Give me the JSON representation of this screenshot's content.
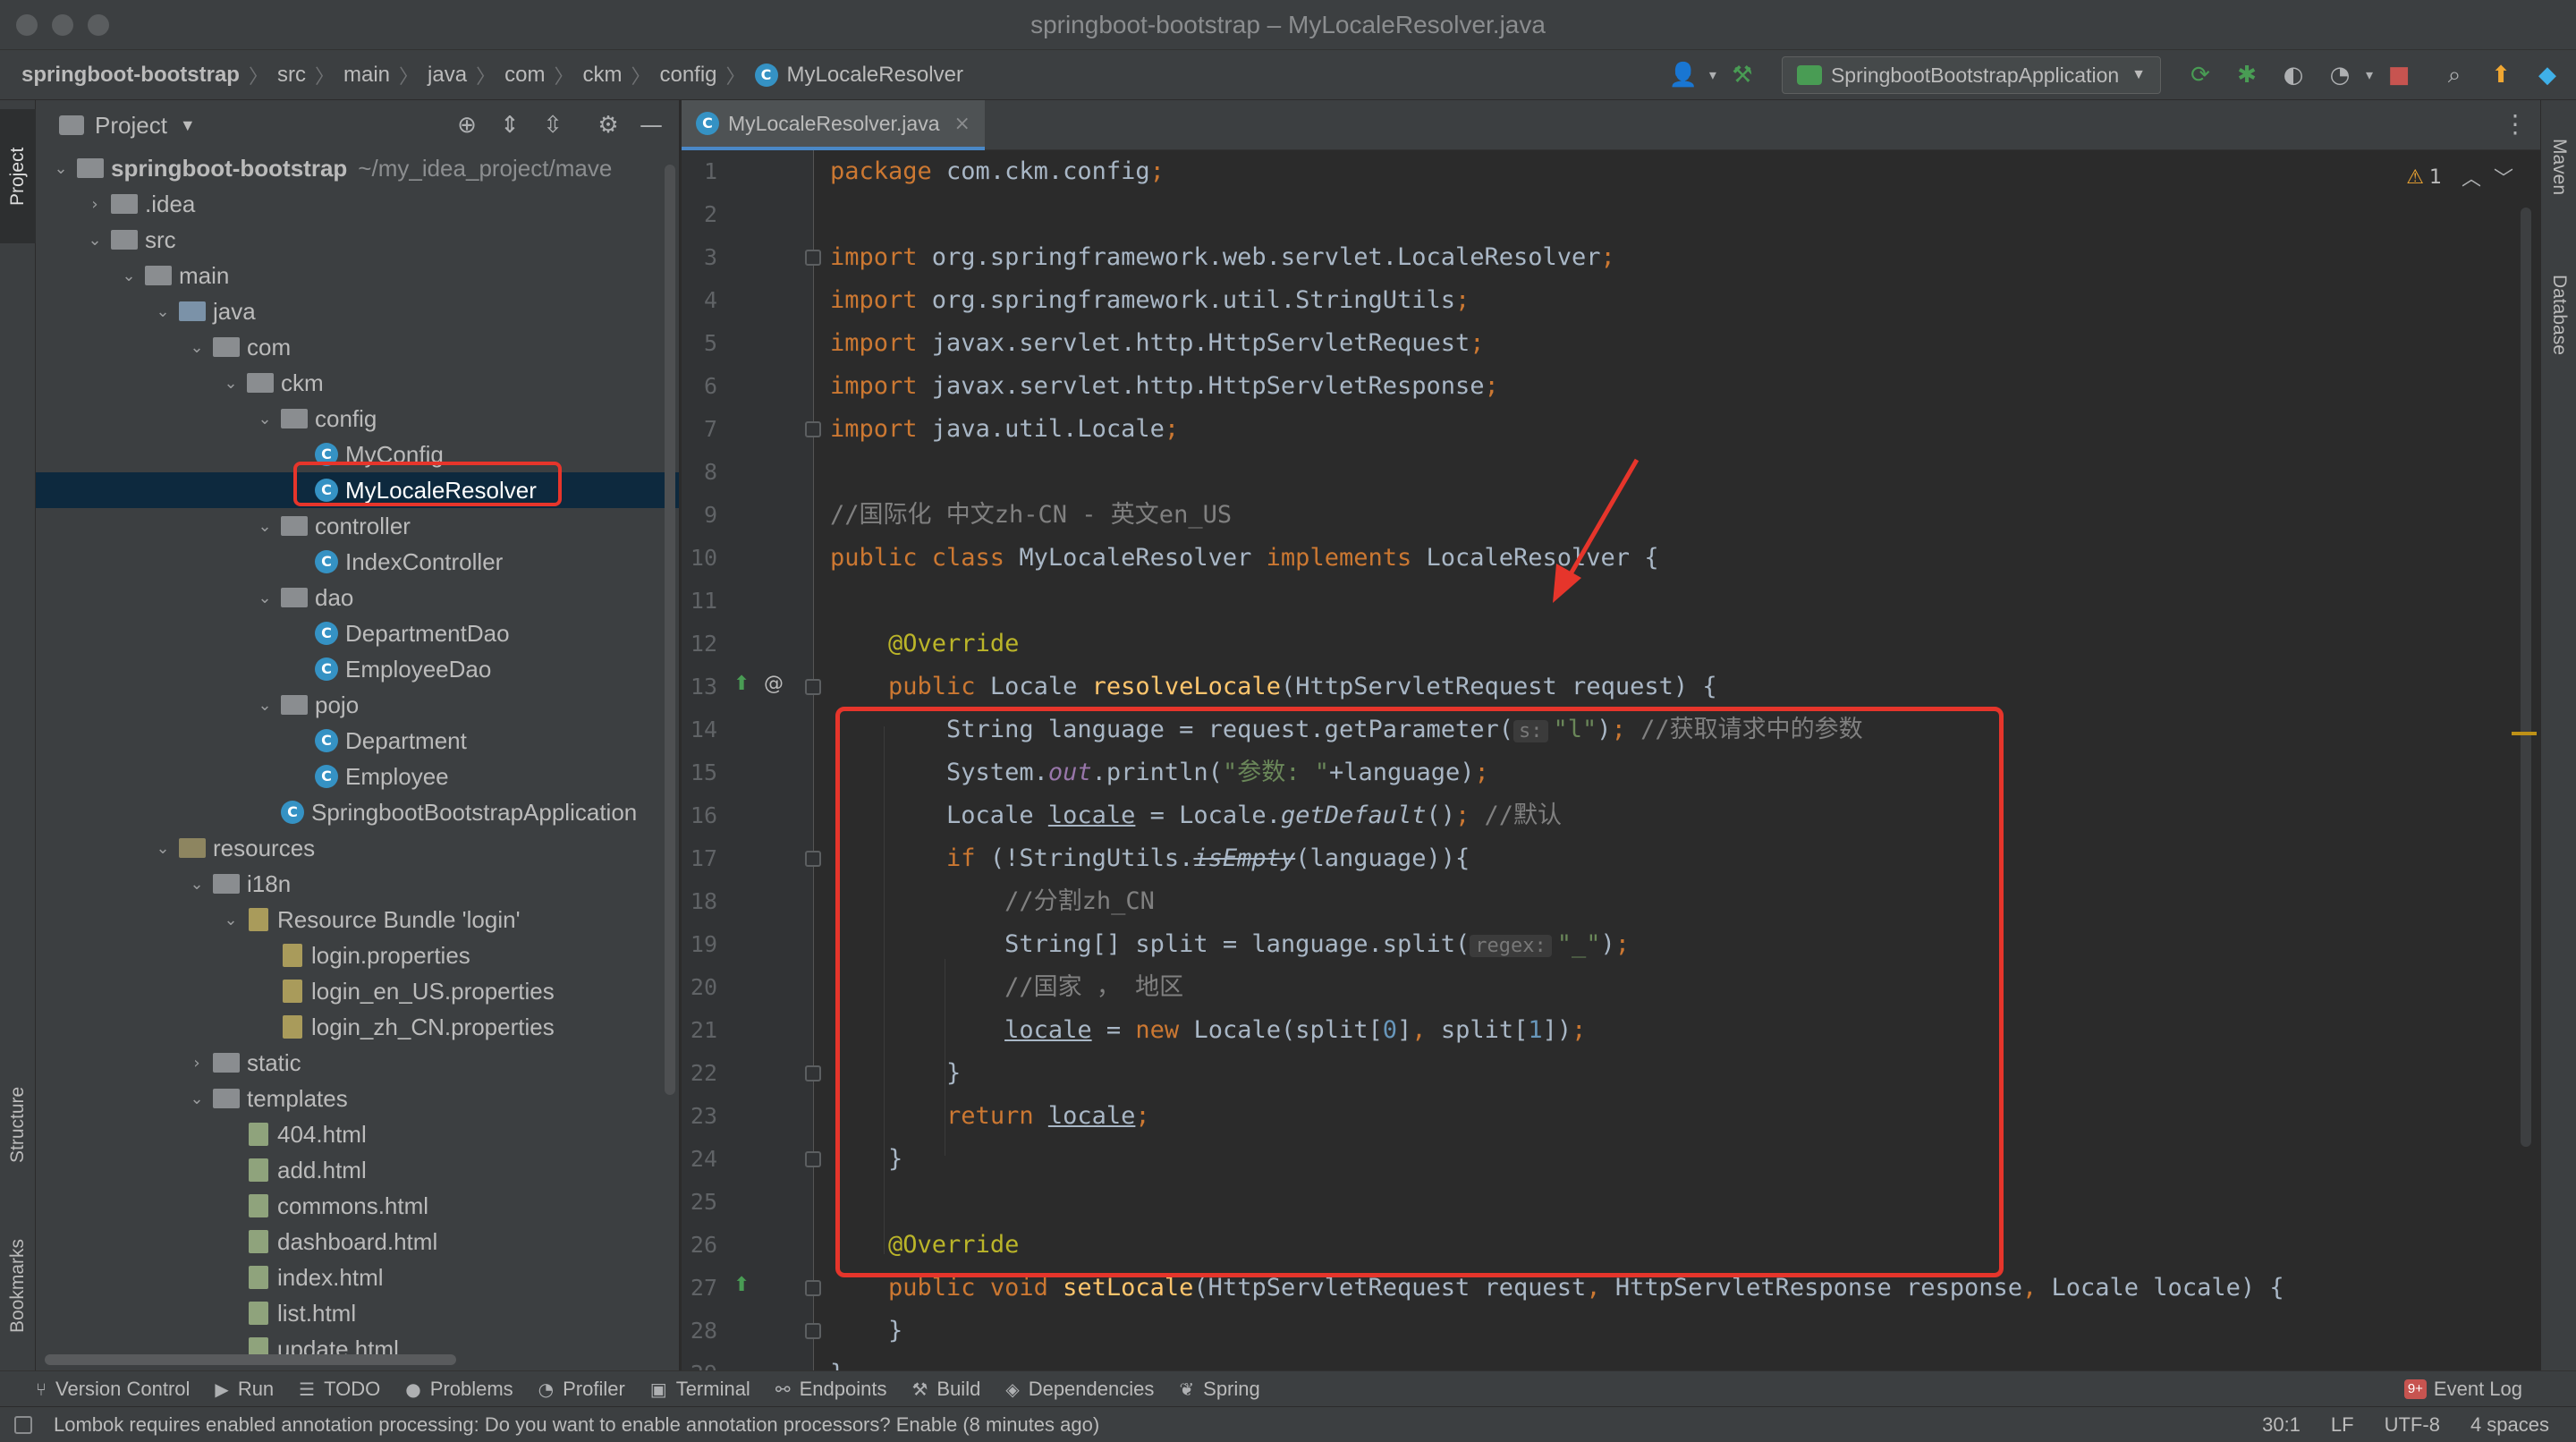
{
  "window": {
    "title": "springboot-bootstrap – MyLocaleResolver.java"
  },
  "breadcrumbs": [
    "springboot-bootstrap",
    "src",
    "main",
    "java",
    "com",
    "ckm",
    "config",
    "MyLocaleResolver"
  ],
  "run_config": {
    "label": "SpringbootBootstrapApplication"
  },
  "toolbar_icons": [
    "user-icon",
    "build-hammer-icon",
    "rerun-icon",
    "debug-icon",
    "coverage-icon",
    "profile-icon",
    "stop-icon",
    "search-icon",
    "update-icon",
    "plugin-icon"
  ],
  "left_strip": {
    "project": "Project",
    "structure": "Structure",
    "bookmarks": "Bookmarks"
  },
  "right_strip": {
    "maven": "Maven",
    "database": "Database"
  },
  "project_panel": {
    "title": "Project",
    "tree": [
      {
        "label": "springboot-bootstrap",
        "extra": "~/my_idea_project/mave",
        "type": "module",
        "depth": 0,
        "expanded": true,
        "bold": true
      },
      {
        "label": ".idea",
        "type": "folder",
        "depth": 1,
        "expanded": false
      },
      {
        "label": "src",
        "type": "folder",
        "depth": 1,
        "expanded": true
      },
      {
        "label": "main",
        "type": "folder",
        "depth": 2,
        "expanded": true
      },
      {
        "label": "java",
        "type": "src",
        "depth": 3,
        "expanded": true
      },
      {
        "label": "com",
        "type": "folder",
        "depth": 4,
        "expanded": true
      },
      {
        "label": "ckm",
        "type": "folder",
        "depth": 5,
        "expanded": true
      },
      {
        "label": "config",
        "type": "folder",
        "depth": 6,
        "expanded": true
      },
      {
        "label": "MyConfig",
        "type": "class",
        "depth": 7
      },
      {
        "label": "MyLocaleResolver",
        "type": "class",
        "depth": 7,
        "selected": true
      },
      {
        "label": "controller",
        "type": "folder",
        "depth": 6,
        "expanded": true
      },
      {
        "label": "IndexController",
        "type": "class",
        "depth": 7
      },
      {
        "label": "dao",
        "type": "folder",
        "depth": 6,
        "expanded": true
      },
      {
        "label": "DepartmentDao",
        "type": "class",
        "depth": 7
      },
      {
        "label": "EmployeeDao",
        "type": "class",
        "depth": 7
      },
      {
        "label": "pojo",
        "type": "folder",
        "depth": 6,
        "expanded": true
      },
      {
        "label": "Department",
        "type": "class",
        "depth": 7
      },
      {
        "label": "Employee",
        "type": "class",
        "depth": 7
      },
      {
        "label": "SpringbootBootstrapApplication",
        "type": "class",
        "depth": 6
      },
      {
        "label": "resources",
        "type": "res",
        "depth": 3,
        "expanded": true
      },
      {
        "label": "i18n",
        "type": "folder",
        "depth": 4,
        "expanded": true
      },
      {
        "label": "Resource Bundle 'login'",
        "type": "bundle",
        "depth": 5,
        "expanded": true
      },
      {
        "label": "login.properties",
        "type": "props",
        "depth": 6
      },
      {
        "label": "login_en_US.properties",
        "type": "props",
        "depth": 6
      },
      {
        "label": "login_zh_CN.properties",
        "type": "props",
        "depth": 6
      },
      {
        "label": "static",
        "type": "folder",
        "depth": 4,
        "expanded": false
      },
      {
        "label": "templates",
        "type": "folder",
        "depth": 4,
        "expanded": true
      },
      {
        "label": "404.html",
        "type": "html",
        "depth": 5
      },
      {
        "label": "add.html",
        "type": "html",
        "depth": 5
      },
      {
        "label": "commons.html",
        "type": "html",
        "depth": 5
      },
      {
        "label": "dashboard.html",
        "type": "html",
        "depth": 5
      },
      {
        "label": "index.html",
        "type": "html",
        "depth": 5
      },
      {
        "label": "list.html",
        "type": "html",
        "depth": 5
      },
      {
        "label": "update.html",
        "type": "html",
        "depth": 5
      }
    ]
  },
  "editor": {
    "tab_label": "MyLocaleResolver.java",
    "inspection": {
      "warnings": "1"
    },
    "lines": [
      {
        "n": "1",
        "t": [
          [
            "kw",
            "package "
          ],
          [
            "",
            "com.ckm.config"
          ],
          [
            "kw",
            ";"
          ]
        ]
      },
      {
        "n": "2",
        "t": []
      },
      {
        "n": "3",
        "t": [
          [
            "kw",
            "import "
          ],
          [
            "",
            "org.springframework.web.servlet.LocaleResolver"
          ],
          [
            "kw",
            ";"
          ]
        ]
      },
      {
        "n": "4",
        "t": [
          [
            "kw",
            "import "
          ],
          [
            "",
            "org.springframework.util.StringUtils"
          ],
          [
            "kw",
            ";"
          ]
        ]
      },
      {
        "n": "5",
        "t": [
          [
            "kw",
            "import "
          ],
          [
            "",
            "javax.servlet.http.HttpServletRequest"
          ],
          [
            "kw",
            ";"
          ]
        ]
      },
      {
        "n": "6",
        "t": [
          [
            "kw",
            "import "
          ],
          [
            "",
            "javax.servlet.http.HttpServletResponse"
          ],
          [
            "kw",
            ";"
          ]
        ]
      },
      {
        "n": "7",
        "t": [
          [
            "kw",
            "import "
          ],
          [
            "",
            "java.util.Locale"
          ],
          [
            "kw",
            ";"
          ]
        ]
      },
      {
        "n": "8",
        "t": []
      },
      {
        "n": "9",
        "t": [
          [
            "cm",
            "//国际化 中文zh-CN - 英文en_US"
          ]
        ]
      },
      {
        "n": "10",
        "t": [
          [
            "kw",
            "public class "
          ],
          [
            "",
            "MyLocaleResolver "
          ],
          [
            "kw",
            "implements "
          ],
          [
            "",
            "LocaleResolver {"
          ]
        ]
      },
      {
        "n": "11",
        "t": []
      },
      {
        "n": "12",
        "t": [
          [
            "",
            "    "
          ],
          [
            "an",
            "@Override"
          ]
        ]
      },
      {
        "n": "13",
        "t": [
          [
            "",
            "    "
          ],
          [
            "kw",
            "public "
          ],
          [
            "",
            "Locale "
          ],
          [
            "fn",
            "resolveLocale"
          ],
          [
            "",
            "(HttpServletRequest request) {"
          ]
        ]
      },
      {
        "n": "14",
        "t": [
          [
            "",
            "        String language = request.getParameter("
          ],
          [
            "hint",
            "s:"
          ],
          [
            "",
            ""
          ],
          [
            "st",
            "\"l\""
          ],
          [
            "",
            ")"
          ],
          [
            "kw",
            "; "
          ],
          [
            "cm",
            "//获取请求中的参数"
          ]
        ]
      },
      {
        "n": "15",
        "t": [
          [
            "",
            "        System."
          ],
          [
            "it",
            "out"
          ],
          [
            "",
            ".println("
          ],
          [
            "st",
            "\"参数: \""
          ],
          [
            "",
            "+language)"
          ],
          [
            "kw",
            ";"
          ]
        ]
      },
      {
        "n": "16",
        "t": [
          [
            "",
            "        Locale "
          ],
          [
            "ul",
            "locale"
          ],
          [
            "",
            " = Locale."
          ],
          [
            "itf",
            "getDefault"
          ],
          [
            "",
            "()"
          ],
          [
            "kw",
            "; "
          ],
          [
            "cm",
            "//默认"
          ]
        ]
      },
      {
        "n": "17",
        "t": [
          [
            "",
            "        "
          ],
          [
            "kw",
            "if "
          ],
          [
            "",
            "(!StringUtils."
          ],
          [
            "strike",
            "isEmpty"
          ],
          [
            "",
            "(language)){"
          ]
        ]
      },
      {
        "n": "18",
        "t": [
          [
            "",
            "            "
          ],
          [
            "cm",
            "//分割zh_CN"
          ]
        ]
      },
      {
        "n": "19",
        "t": [
          [
            "",
            "            String[] split = language.split("
          ],
          [
            "hint",
            "regex:"
          ],
          [
            "",
            ""
          ],
          [
            "st",
            "\"_\""
          ],
          [
            "",
            ")"
          ],
          [
            "kw",
            ";"
          ]
        ]
      },
      {
        "n": "20",
        "t": [
          [
            "",
            "            "
          ],
          [
            "cm",
            "//国家 ， 地区"
          ]
        ]
      },
      {
        "n": "21",
        "t": [
          [
            "",
            "            "
          ],
          [
            "ul",
            "locale"
          ],
          [
            "",
            " = "
          ],
          [
            "kw",
            "new "
          ],
          [
            "",
            "Locale(split["
          ],
          [
            "num",
            "0"
          ],
          [
            "",
            "]"
          ],
          [
            "kw",
            ", "
          ],
          [
            "",
            "split["
          ],
          [
            "num",
            "1"
          ],
          [
            "",
            "])"
          ],
          [
            "kw",
            ";"
          ]
        ]
      },
      {
        "n": "22",
        "t": [
          [
            "",
            "        }"
          ]
        ]
      },
      {
        "n": "23",
        "t": [
          [
            "",
            "        "
          ],
          [
            "kw",
            "return "
          ],
          [
            "ul",
            "locale"
          ],
          [
            "kw",
            ";"
          ]
        ]
      },
      {
        "n": "24",
        "t": [
          [
            "",
            "    }"
          ]
        ]
      },
      {
        "n": "25",
        "t": []
      },
      {
        "n": "26",
        "t": [
          [
            "",
            "    "
          ],
          [
            "an",
            "@Override"
          ]
        ]
      },
      {
        "n": "27",
        "t": [
          [
            "",
            "    "
          ],
          [
            "kw",
            "public void "
          ],
          [
            "fn",
            "setLocale"
          ],
          [
            "",
            "(HttpServletRequest request"
          ],
          [
            "kw",
            ", "
          ],
          [
            "",
            "HttpServletResponse response"
          ],
          [
            "kw",
            ", "
          ],
          [
            "",
            "Locale locale) {"
          ]
        ]
      },
      {
        "n": "28",
        "t": [
          [
            "",
            "    }"
          ]
        ]
      },
      {
        "n": "29",
        "t": [
          [
            "",
            "}"
          ]
        ]
      }
    ]
  },
  "bottom_tools": [
    {
      "label": "Version Control",
      "icon": "git-branch-icon",
      "glyph": "⑂"
    },
    {
      "label": "Run",
      "icon": "run-icon",
      "glyph": "▶"
    },
    {
      "label": "TODO",
      "icon": "todo-icon",
      "glyph": "☰"
    },
    {
      "label": "Problems",
      "icon": "problems-icon",
      "glyph": "●"
    },
    {
      "label": "Profiler",
      "icon": "profiler-icon",
      "glyph": "◔"
    },
    {
      "label": "Terminal",
      "icon": "terminal-icon",
      "glyph": "▣"
    },
    {
      "label": "Endpoints",
      "icon": "endpoints-icon",
      "glyph": "⚯"
    },
    {
      "label": "Build",
      "icon": "build-icon",
      "glyph": "⚒"
    },
    {
      "label": "Dependencies",
      "icon": "dependencies-icon",
      "glyph": "◈"
    },
    {
      "label": "Spring",
      "icon": "spring-icon",
      "glyph": "❦"
    }
  ],
  "event_log": {
    "label": "Event Log",
    "badge": "9+"
  },
  "status": {
    "message": "Lombok requires enabled annotation processing: Do you want to enable annotation processors? Enable (8 minutes ago)",
    "position": "30:1",
    "line_sep": "LF",
    "encoding": "UTF-8",
    "indent": "4 spaces"
  },
  "colors": {
    "highlight": "#e6352b",
    "selection": "#0d293e",
    "keyword": "#cc7832",
    "annotation": "#bbb529",
    "string": "#6a8759",
    "comment": "#808080",
    "method": "#ffc66d"
  }
}
